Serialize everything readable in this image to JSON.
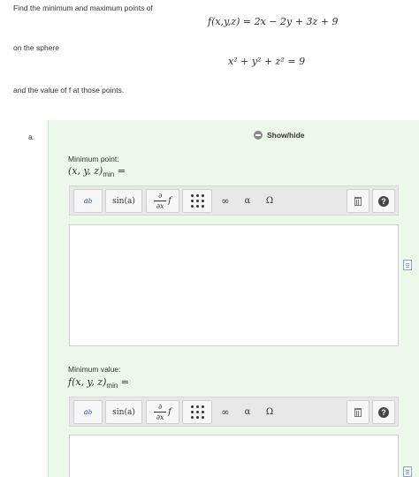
{
  "question": {
    "intro": "Find the minimum and maximum points of",
    "function": "f(x,y,z) = 2x − 2y + 3z + 9",
    "sphere_label": "on the sphere",
    "sphere": "x² + y² + z² = 9",
    "tail": "and the value of f at those points."
  },
  "part": {
    "label": "a.",
    "showhide": "Show/hide",
    "min_point_label": "Minimum point:",
    "min_point_eq_base": "(x, y, z)",
    "min_point_eq_sub": "min",
    "min_value_label": "Minimum value:",
    "min_value_eq_base": "f(x, y, z)",
    "min_value_eq_sub": "min",
    "eq_sign": "="
  },
  "toolbar": {
    "superscript": "a",
    "superscript_exp": "b",
    "trig": "sin(a)",
    "deriv_num": "∂",
    "deriv_den": "∂x",
    "deriv_f": "f",
    "infinity": "∞",
    "alpha": "α",
    "omega": "Ω",
    "help": "?"
  },
  "icons": [
    "minus-circle-icon",
    "matrix-icon",
    "trash-icon",
    "help-icon",
    "document-icon"
  ]
}
